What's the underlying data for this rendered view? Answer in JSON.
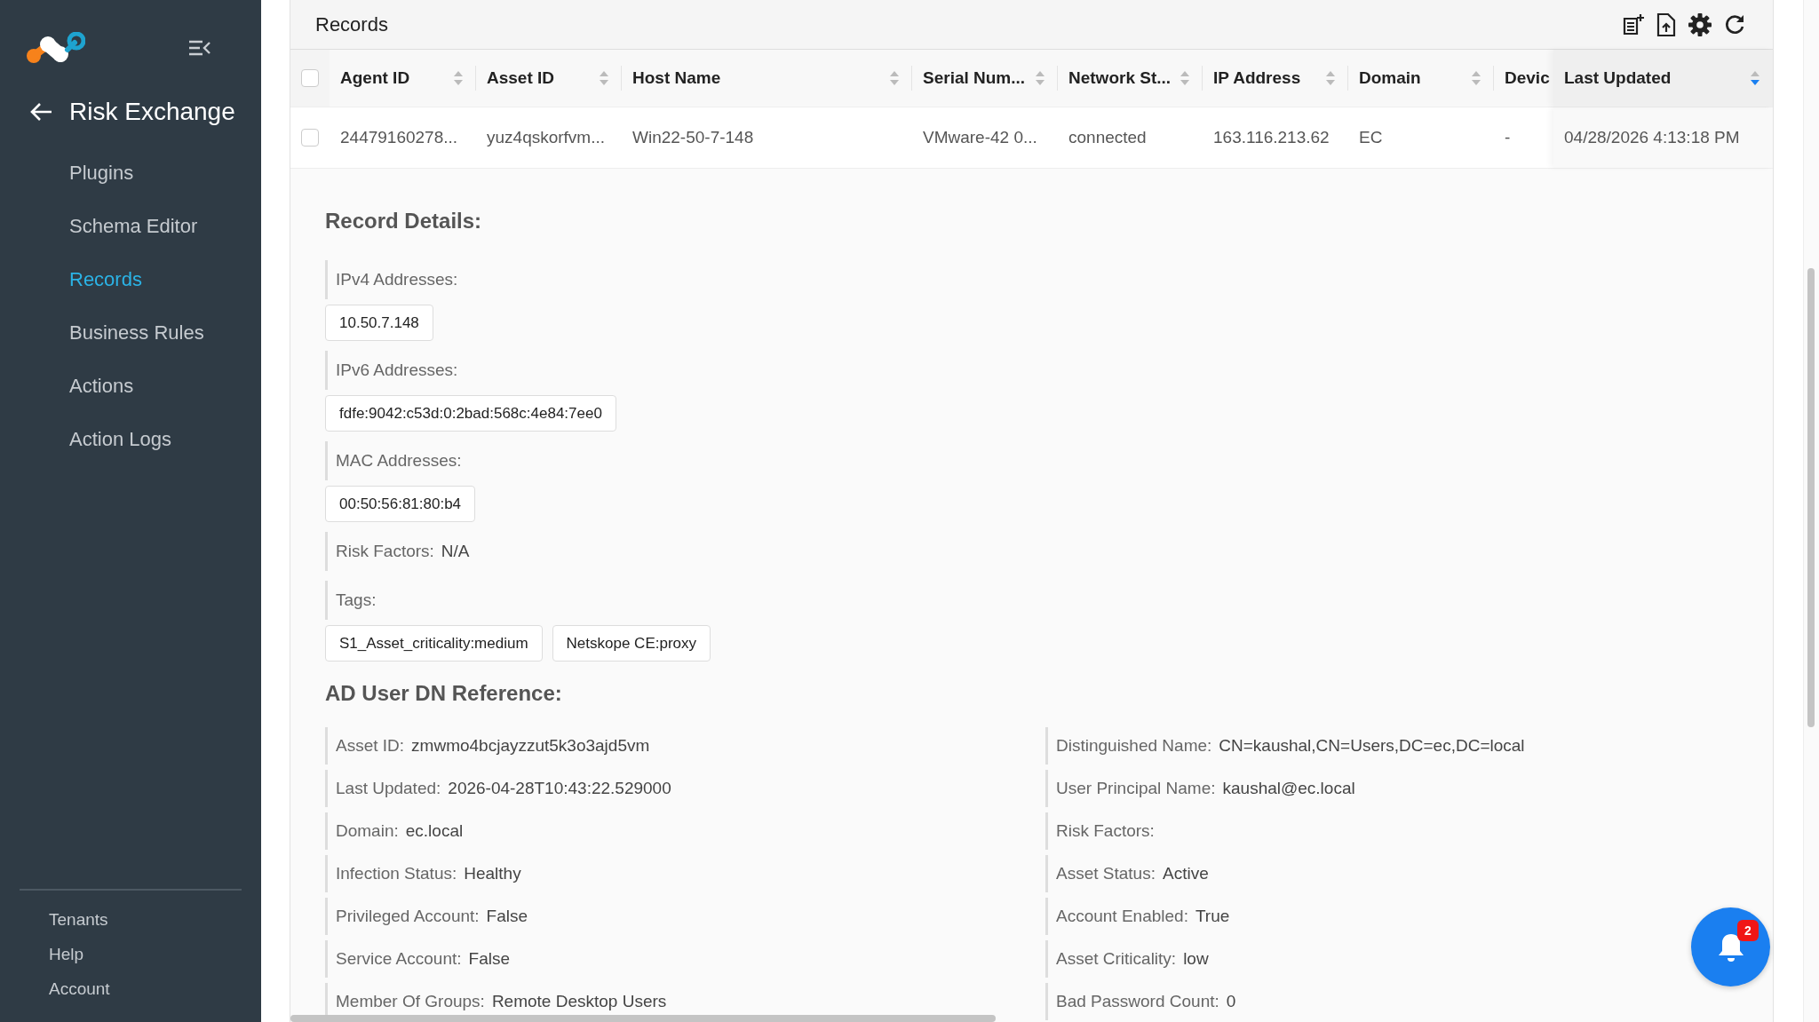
{
  "sidebar": {
    "title": "Risk Exchange",
    "items": [
      {
        "label": "Plugins",
        "selected": false
      },
      {
        "label": "Schema Editor",
        "selected": false
      },
      {
        "label": "Records",
        "selected": true
      },
      {
        "label": "Business Rules",
        "selected": false
      },
      {
        "label": "Actions",
        "selected": false
      },
      {
        "label": "Action Logs",
        "selected": false
      }
    ],
    "footer_items": [
      "Tenants",
      "Help",
      "Account"
    ]
  },
  "page": {
    "title": "Records"
  },
  "table": {
    "header_checkbox": {
      "checked": false
    },
    "columns": [
      {
        "label": "Agent ID",
        "sorted": false
      },
      {
        "label": "Asset ID",
        "sorted": false
      },
      {
        "label": "Host Name",
        "sorted": false
      },
      {
        "label": "Serial Num...",
        "sorted": false
      },
      {
        "label": "Network St...",
        "sorted": false
      },
      {
        "label": "IP Address",
        "sorted": false
      },
      {
        "label": "Domain",
        "sorted": false
      },
      {
        "label": "Devic"
      },
      {
        "label": "Last Updated",
        "sorted": true
      }
    ],
    "rows": [
      {
        "checked": false,
        "cells": [
          "24479160278...",
          "yuz4qskorfvm...",
          "Win22-50-7-148",
          "VMware-42 0...",
          "connected",
          "163.116.213.62",
          "EC",
          "-",
          "04/28/2026 4:13:18 PM"
        ]
      }
    ]
  },
  "details": {
    "title": "Record Details:",
    "sections": [
      {
        "kind": "list",
        "label": "IPv4 Addresses:",
        "values": [
          "10.50.7.148"
        ]
      },
      {
        "kind": "list",
        "label": "IPv6 Addresses:",
        "values": [
          "fdfe:9042:c53d:0:2bad:568c:4e84:7ee0"
        ]
      },
      {
        "kind": "list",
        "label": "MAC Addresses:",
        "values": [
          "00:50:56:81:80:b4"
        ]
      },
      {
        "kind": "field",
        "label": "Risk Factors:",
        "value": "N/A"
      },
      {
        "kind": "list",
        "label": "Tags:",
        "values": [
          "S1_Asset_criticality:medium",
          "Netskope CE:proxy"
        ]
      }
    ]
  },
  "reference": {
    "title": "AD User DN Reference:",
    "left": [
      {
        "label": "Asset ID:",
        "value": "zmwmo4bcjayzzut5k3o3ajd5vm"
      },
      {
        "label": "Last Updated:",
        "value": "2026-04-28T10:43:22.529000"
      },
      {
        "label": "Domain:",
        "value": "ec.local"
      },
      {
        "label": "Infection Status:",
        "value": "Healthy"
      },
      {
        "label": "Privileged Account:",
        "value": "False"
      },
      {
        "label": "Service Account:",
        "value": "False"
      },
      {
        "label": "Member Of Groups:",
        "value": "Remote Desktop Users"
      }
    ],
    "right": [
      {
        "label": "Distinguished Name:",
        "value": "CN=kaushal,CN=Users,DC=ec,DC=local"
      },
      {
        "label": "User Principal Name:",
        "value": "kaushal@ec.local"
      },
      {
        "label": "Risk Factors:"
      },
      {
        "label": "Asset Status:",
        "value": "Active"
      },
      {
        "label": "Account Enabled:",
        "value": "True"
      },
      {
        "label": "Asset Criticality:",
        "value": "low"
      },
      {
        "label": "Bad Password Count:",
        "value": "0"
      }
    ]
  },
  "notifications": {
    "count": "2"
  }
}
